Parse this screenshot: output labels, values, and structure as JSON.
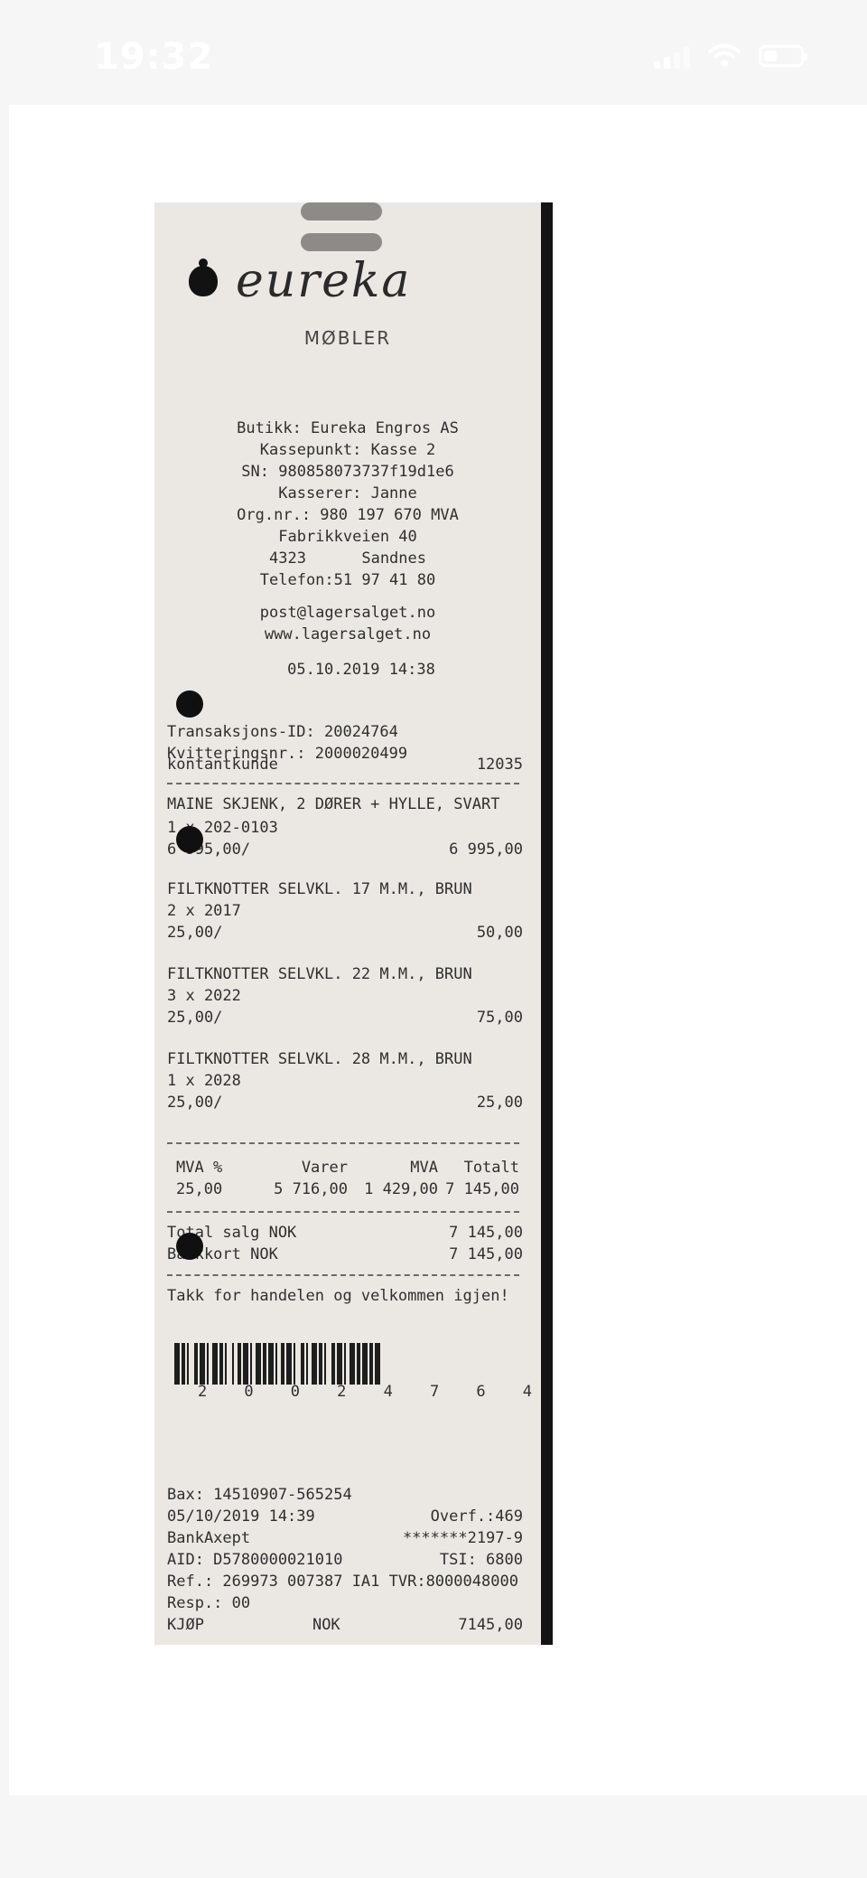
{
  "status_bar": {
    "time": "19:32",
    "icons": [
      "signal-icon",
      "wifi-icon",
      "battery-icon"
    ]
  },
  "receipt": {
    "logo_text": "eureka",
    "subtitle": "MØBLER",
    "store_info": [
      "Butikk: Eureka Engros AS",
      "Kassepunkt: Kasse 2",
      "SN: 980858073737f19d1e6",
      "Kasserer: Janne",
      "Org.nr.: 980 197 670 MVA",
      "Fabrikkveien 40",
      "4323      Sandnes",
      "Telefon:51 97 41 80"
    ],
    "contact": [
      "post@lagersalget.no",
      "www.lagersalget.no"
    ],
    "datetime": "05.10.2019 14:38",
    "transaction_id": "Transaksjons-ID: 20024764",
    "receipt_no": "Kvitteringsnr.: 2000020499",
    "customer": "kontantkunde",
    "customer_no": "12035",
    "items": [
      {
        "name": "MAINE SKJENK, 2 DØRER + HYLLE, SVART",
        "qty": "1 x 202-0103",
        "unit": "6 995,00/",
        "total": "6 995,00"
      },
      {
        "name": "FILTKNOTTER SELVKL. 17 M.M., BRUN",
        "qty": "2 x 2017",
        "unit": "25,00/",
        "total": "50,00"
      },
      {
        "name": "FILTKNOTTER SELVKL. 22 M.M., BRUN",
        "qty": "3 x 2022",
        "unit": "25,00/",
        "total": "75,00"
      },
      {
        "name": "FILTKNOTTER SELVKL. 28 M.M., BRUN",
        "qty": "1 x 2028",
        "unit": "25,00/",
        "total": "25,00"
      }
    ],
    "vat_headers": [
      "MVA %",
      "Varer",
      "MVA",
      "Totalt"
    ],
    "vat_values": [
      "25,00",
      "5 716,00",
      "1 429,00",
      "7 145,00"
    ],
    "total_label": "Total salg NOK",
    "total_value": "7 145,00",
    "payment_label": "Bankkort NOK",
    "payment_value": "7 145,00",
    "thanks": "Takk for handelen og velkommen igjen!",
    "barcode_digits": [
      "2",
      "0",
      "0",
      "2",
      "4",
      "7",
      "6",
      "4"
    ],
    "terminal": {
      "bax": "Bax: 14510907-565254",
      "date": "05/10/2019 14:39",
      "overf": "Overf.:469",
      "bank": "BankAxept",
      "card": "*******2197-9",
      "aid": "AID: D5780000021010",
      "tsi": "TSI: 6800",
      "ref": "Ref.: 269973 007387 IA1 TVR:8000048000",
      "resp": "Resp.: 00",
      "kjop": "KJØP",
      "currency": "NOK",
      "amount": "7145,00"
    }
  }
}
